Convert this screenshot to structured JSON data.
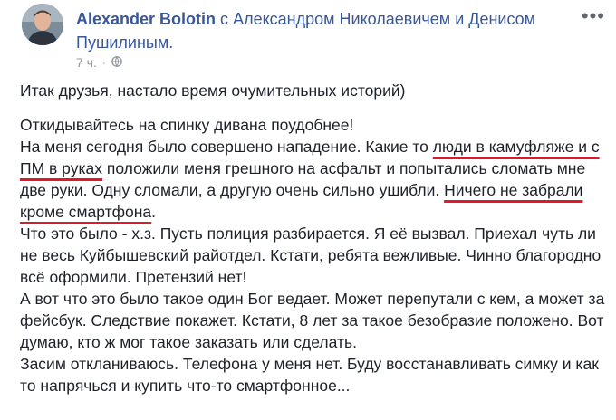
{
  "author": {
    "name": "Alexander Bolotin",
    "with_prefix": "с",
    "tagged_1": "Александром Николаевичем",
    "conjunction": "и",
    "tagged_2": "Денисом Пушилиным."
  },
  "meta": {
    "time": "7 ч.",
    "separator": "·",
    "privacy_icon": "globe-icon"
  },
  "menu_icon": "more-options-icon",
  "post": {
    "intro": "Итак друзья, настало время очумительных историй)",
    "p1_a": "Откидывайтесь на спинку дивана поудобнее!",
    "p1_b": "На меня сегодня было совершено нападение. Какие то ",
    "p1_hl1": "люди в камуфляже и с ПМ в руках",
    "p1_c": " положили меня грешного на асфальт и попытались сломать мне две руки. Одну сломали, а другую очень сильно ушибли. ",
    "p1_hl2": "Ничего не забрали кроме смартфона",
    "p1_d": ".",
    "p2": "Что это было - х.з. Пусть полиция разбирается. Я её вызвал. Приехал чуть ли не весь Куйбышевский райотдел. Кстати, ребята вежливые. Чинно благородно всё оформили. Претензий нет!",
    "p3": "А вот что это было такое один Бог ведает. Может перепутали с кем, а может за фейсбук. Следствие покажет. Кстати, 8 лет за такое безобразие положено. Вот думаю, кто ж мог такое заказать или сделать.",
    "p4": "Засим откланиваюсь. Телефона у меня нет. Буду восстанавливать симку и как то напрячься и купить что-то смартфонное..."
  },
  "colors": {
    "link": "#385898",
    "text": "#1d2129",
    "meta": "#90949c",
    "highlight_underline": "#e0182c"
  }
}
